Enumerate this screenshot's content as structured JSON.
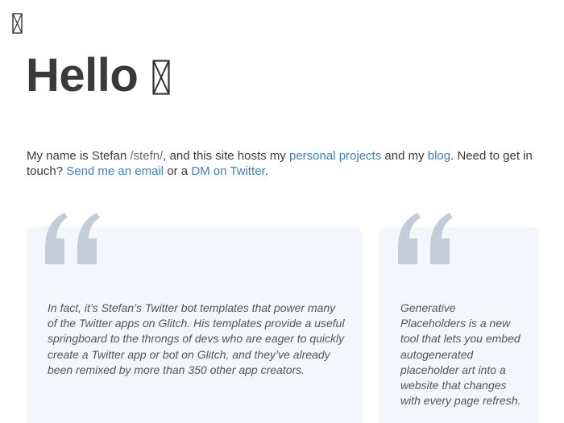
{
  "page": {
    "heading": "Hello",
    "intro": {
      "name_prefix": "My name is Stefan ",
      "pronunciation": "/stefn/",
      "after_pron": ", and this site hosts my ",
      "projects_link": "personal projects",
      "and_my": " and my ",
      "blog_link": "blog",
      "need_touch": ". Need to get in touch? ",
      "email_link": "Send me an email",
      "or_a": " or a ",
      "twitter_link": "DM on Twitter",
      "end": "."
    }
  },
  "testimonials": [
    {
      "text": "In fact, it’s Stefan’s Twitter bot templates that power many of the Twitter apps on Glitch. His templates provide a useful springboard to the throngs of devs who are eager to quickly create a Twitter app or bot on Glitch, and they’ve already been remixed by more than 350 other app creators."
    },
    {
      "text": "Generative Placeholders is a new tool that lets you embed autogenerated placeholder art into a website that changes with every page refresh."
    }
  ],
  "icons": {
    "corner": "missing-glyph-icon",
    "wave": "missing-glyph-icon",
    "quote": "quote-mark-icon"
  },
  "colors": {
    "text": "#3a3a3a",
    "link": "#3b82c4",
    "card_bg": "#f3f6fa",
    "quote_mark": "#c3cdd9"
  }
}
